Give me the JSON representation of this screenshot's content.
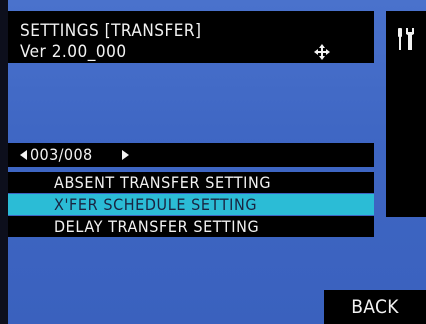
{
  "header": {
    "title": "SETTINGS [TRANSFER]",
    "version": "Ver 2.00_000",
    "move_icon": "four-way-arrow-icon"
  },
  "side_panel": {
    "icon": "wrench-screwdriver-icon"
  },
  "pager": {
    "text": "003/008"
  },
  "menu": {
    "items": [
      {
        "label": "ABSENT TRANSFER SETTING",
        "selected": false
      },
      {
        "label": "X'FER SCHEDULE SETTING",
        "selected": true
      },
      {
        "label": "DELAY TRANSFER SETTING",
        "selected": false
      }
    ]
  },
  "footer": {
    "back_label": "BACK"
  },
  "colors": {
    "background": "#3f67c4",
    "panel": "#000000",
    "highlight": "#2bbcd6",
    "text": "#f2f2f2"
  }
}
